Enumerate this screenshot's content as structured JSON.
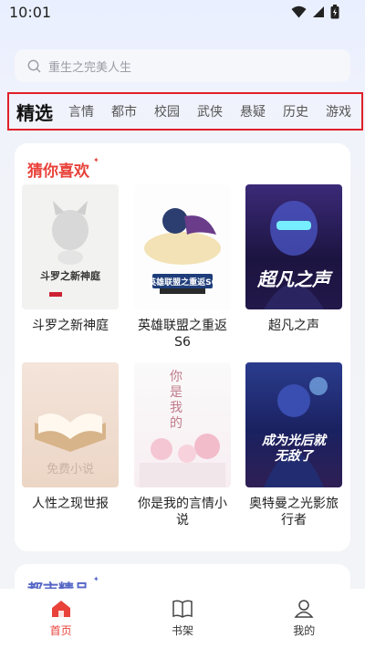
{
  "status": {
    "time": "10:01"
  },
  "search": {
    "placeholder": "重生之完美人生"
  },
  "categories": [
    {
      "label": "精选",
      "active": true
    },
    {
      "label": "言情"
    },
    {
      "label": "都市"
    },
    {
      "label": "校园"
    },
    {
      "label": "武侠"
    },
    {
      "label": "悬疑"
    },
    {
      "label": "历史"
    },
    {
      "label": "游戏"
    }
  ],
  "recommend": {
    "title": "猜你喜欢",
    "books": [
      {
        "title": "斗罗之新神庭",
        "cover_text": "斗罗之新神庭"
      },
      {
        "title": "英雄联盟之重返S6",
        "cover_text": "英雄联盟之重返S6"
      },
      {
        "title": "超凡之声",
        "cover_text": "超凡之声"
      },
      {
        "title": "人性之现世报",
        "cover_text": "免费小说"
      },
      {
        "title": "你是我的言情小说",
        "cover_text": "你是我的"
      },
      {
        "title": "奥特曼之光影旅行者",
        "cover_text": "成为光后就无敌了"
      }
    ]
  },
  "section2": {
    "title": "都市精品"
  },
  "bottom_nav": [
    {
      "label": "首页",
      "icon": "home-icon",
      "active": true
    },
    {
      "label": "书架",
      "icon": "book-icon"
    },
    {
      "label": "我的",
      "icon": "user-icon"
    }
  ],
  "colors": {
    "accent": "#e8423a",
    "highlight_border": "#e0202a",
    "section2_title": "#5566c6"
  }
}
